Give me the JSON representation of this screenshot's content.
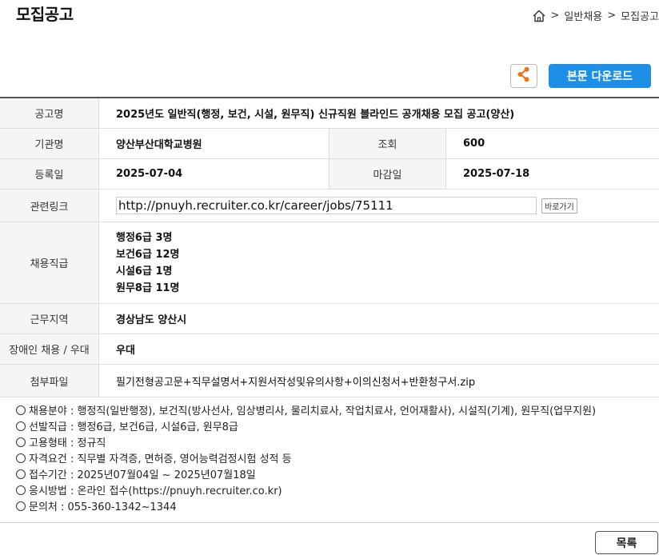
{
  "header": {
    "title": "모집공고",
    "breadcrumb": [
      {
        "label": "일반채용"
      },
      {
        "label": "모집공고"
      }
    ],
    "separator": ">"
  },
  "actions": {
    "share_icon": "share-icon",
    "download_label": "본문 다운로드"
  },
  "colors": {
    "accent": "#1e8fe6",
    "share_icon": "#e8741c"
  },
  "info": {
    "notice_name_label": "공고명",
    "notice_name": "2025년도 일반직(행정, 보건, 시설, 원무직) 신규직원 블라인드 공개채용 모집 공고(양산)",
    "org_label": "기관명",
    "org": "양산부산대학교병원",
    "views_label": "조회",
    "views": "600",
    "reg_date_label": "등록일",
    "reg_date": "2025-07-04",
    "deadline_label": "마감일",
    "deadline": "2025-07-18",
    "link_label": "관련링크",
    "link_url": "http://pnuyh.recruiter.co.kr/career/jobs/75111",
    "link_go": "바로가기",
    "positions_label": "채용직급",
    "positions": [
      "행정6급 3명",
      "보건6급 12명",
      "시설6급 1명",
      "원무8급 11명"
    ],
    "region_label": "근무지역",
    "region": "경상남도 양산시",
    "disability_label": "장애인 채용 / 우대",
    "disability": "우대",
    "attachment_label": "첨부파일",
    "attachment": "필기전형공고문+직무설명서+지원서작성및유의사항+이의신청서+반환청구서.zip"
  },
  "notes": [
    "채용분야 : 행정직(일반행정), 보건직(방사선사, 임상병리사, 물리치료사, 작업치료사, 언어재활사), 시설직(기계), 원무직(업무지원)",
    "선발직급 : 행정6급, 보건6급, 시설6급, 원무8급",
    "고용형태 : 정규직",
    "자격요건 : 직무별 자격증, 면허증, 영어능력검정시험 성적 등",
    "접수기간 : 2025년07월04일 ~ 2025년07월18일",
    "응시방법 : 온라인 접수(https://pnuyh.recruiter.co.kr)",
    "문의처 : 055-360-1342~1344"
  ],
  "footer": {
    "list_label": "목록"
  }
}
